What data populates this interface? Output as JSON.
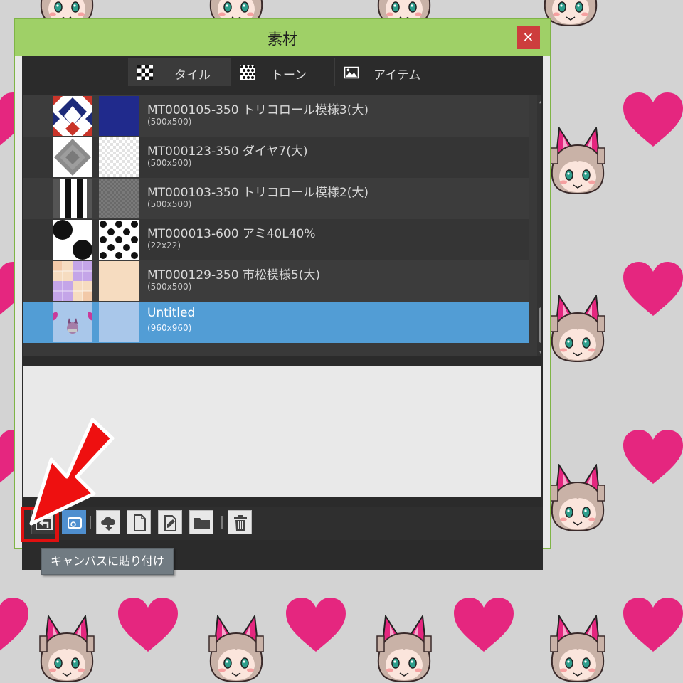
{
  "window": {
    "title": "素材",
    "close_glyph": "✕"
  },
  "tabs": [
    {
      "label": "タイル",
      "icon": "tile-checker-icon",
      "active": true
    },
    {
      "label": "トーン",
      "icon": "tone-dots-icon",
      "active": false
    },
    {
      "label": "アイテム",
      "icon": "image-item-icon",
      "active": false
    }
  ],
  "materials": [
    {
      "name": "MT000105-350 トリコロール模様3(大)",
      "size": "(500x500)",
      "selected": false
    },
    {
      "name": "MT000123-350 ダイヤ7(大)",
      "size": "(500x500)",
      "selected": false
    },
    {
      "name": "MT000103-350 トリコロール模様2(大)",
      "size": "(500x500)",
      "selected": false
    },
    {
      "name": "MT000013-600 アミ40L40%",
      "size": "(22x22)",
      "selected": false
    },
    {
      "name": "MT000129-350 市松模様5(大)",
      "size": "(500x500)",
      "selected": false
    },
    {
      "name": "Untitled",
      "size": "(960x960)",
      "selected": true
    }
  ],
  "toolbar": {
    "buttons": [
      {
        "icon": "paste-to-canvas-icon",
        "tooltip": "キャンバスに貼り付け"
      },
      {
        "icon": "canvas-preview-icon"
      },
      {
        "icon": "cloud-download-icon"
      },
      {
        "icon": "new-file-icon"
      },
      {
        "icon": "edit-file-icon"
      },
      {
        "icon": "folder-icon"
      },
      {
        "icon": "trash-icon"
      }
    ],
    "tooltip": "キャンバスに貼り付け"
  },
  "colors": {
    "titlebar": "#9fd067",
    "selection": "#529dd5",
    "close_button": "#cd3d3d",
    "highlight": "#e01010",
    "heart": "#e5267f"
  }
}
